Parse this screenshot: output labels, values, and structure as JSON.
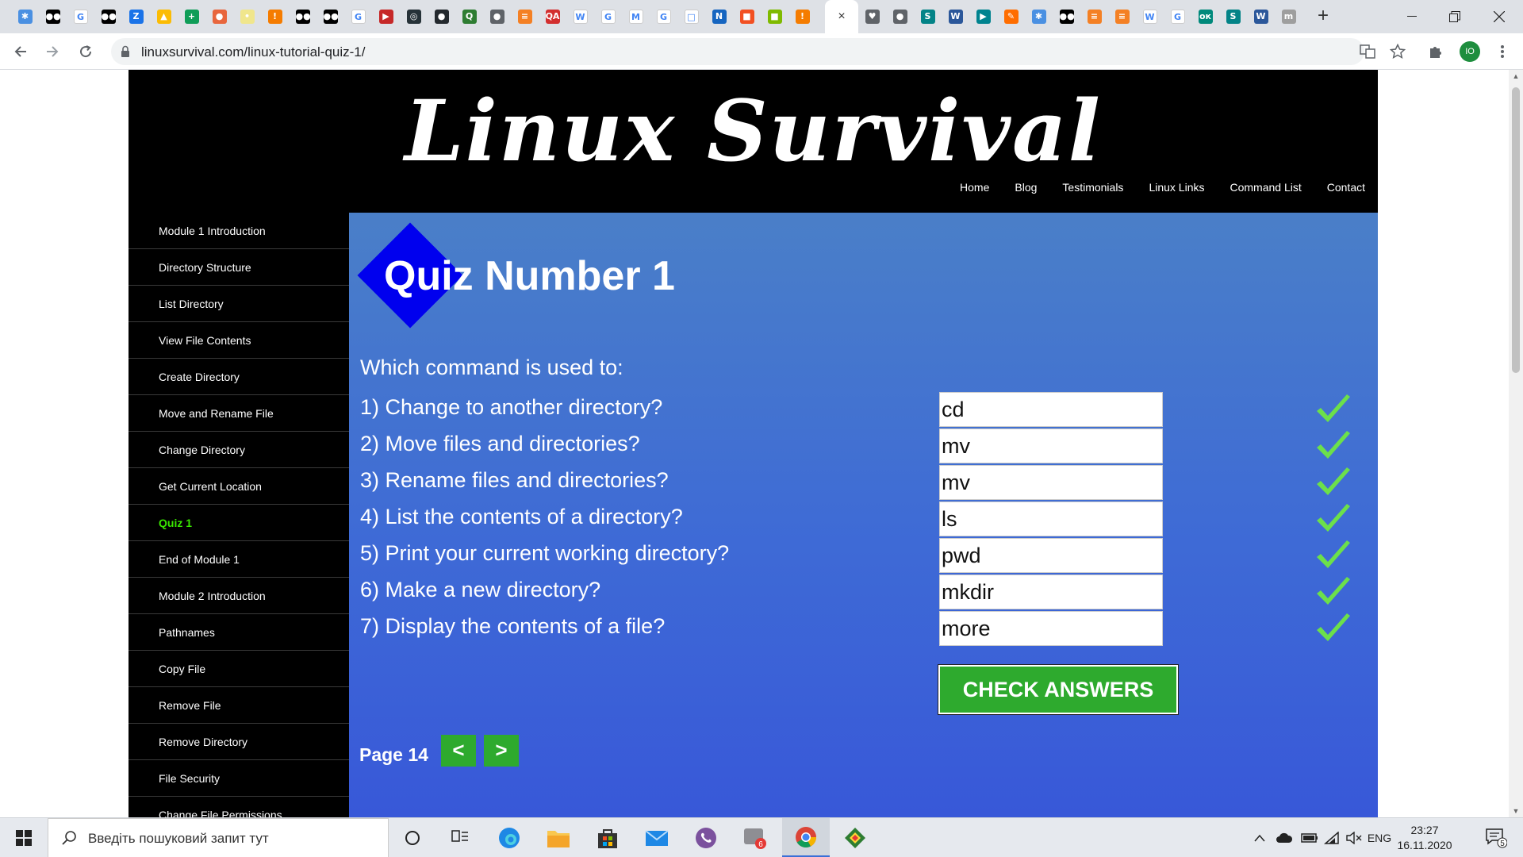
{
  "browser": {
    "url": "linuxsurvival.com/linux-tutorial-quiz-1/",
    "tab_close": "×",
    "new_tab": "+",
    "favicons": [
      {
        "name": "app-tab-icon",
        "color": "#4a90e2",
        "glyph": "✱"
      },
      {
        "name": "medium-tab-icon",
        "color": "#000000",
        "glyph": "●●"
      },
      {
        "name": "google-tab-icon",
        "color": "#ffffff",
        "glyph": "G"
      },
      {
        "name": "medium-tab-icon",
        "color": "#000000",
        "glyph": "●●"
      },
      {
        "name": "z-tab-icon",
        "color": "#1a73e8",
        "glyph": "Z"
      },
      {
        "name": "drive-tab-icon",
        "color": "#fbbc04",
        "glyph": "▲"
      },
      {
        "name": "plus-tab-icon",
        "color": "#0f9d58",
        "glyph": "+"
      },
      {
        "name": "ball-tab-icon",
        "color": "#e8663d",
        "glyph": "●"
      },
      {
        "name": "bulb-tab-icon",
        "color": "#f0e68c",
        "glyph": "•"
      },
      {
        "name": "info-tab-icon",
        "color": "#f57c00",
        "glyph": "!"
      },
      {
        "name": "medium-tab-icon",
        "color": "#000000",
        "glyph": "●●"
      },
      {
        "name": "medium-tab-icon",
        "color": "#000000",
        "glyph": "●●"
      },
      {
        "name": "google-tab-icon",
        "color": "#ffffff",
        "glyph": "G"
      },
      {
        "name": "flag-tab-icon",
        "color": "#c62828",
        "glyph": "▶"
      },
      {
        "name": "circle-tab-icon",
        "color": "#263238",
        "glyph": "◎"
      },
      {
        "name": "github-tab-icon",
        "color": "#24292e",
        "glyph": "●"
      },
      {
        "name": "qa-tab-icon",
        "color": "#2e7d32",
        "glyph": "Q"
      },
      {
        "name": "globe-tab-icon",
        "color": "#5f6368",
        "glyph": "●"
      },
      {
        "name": "stack-tab-icon",
        "color": "#f48024",
        "glyph": "≡"
      },
      {
        "name": "qa-tab-icon",
        "color": "#d32f2f",
        "glyph": "QA"
      },
      {
        "name": "wiki-tab-icon",
        "color": "#ffffff",
        "glyph": "W"
      },
      {
        "name": "google-tab-icon",
        "color": "#ffffff",
        "glyph": "G"
      },
      {
        "name": "gmail-tab-icon",
        "color": "#ffffff",
        "glyph": "M"
      },
      {
        "name": "google-tab-icon",
        "color": "#ffffff",
        "glyph": "G"
      },
      {
        "name": "square-tab-icon",
        "color": "#ffffff",
        "glyph": "□"
      },
      {
        "name": "n-tab-icon",
        "color": "#1565c0",
        "glyph": "N"
      },
      {
        "name": "windows-tab-icon",
        "color": "#f25022",
        "glyph": "■"
      },
      {
        "name": "windows-tab-icon",
        "color": "#7fba00",
        "glyph": "■"
      },
      {
        "name": "info-tab-icon",
        "color": "#f57c00",
        "glyph": "!"
      }
    ],
    "favicons_right": [
      {
        "name": "pocket-tab-icon",
        "color": "#5f6368",
        "glyph": "♥"
      },
      {
        "name": "globe-tab-icon",
        "color": "#5f6368",
        "glyph": "●"
      },
      {
        "name": "sharepoint-tab-icon",
        "color": "#038387",
        "glyph": "S"
      },
      {
        "name": "word-tab-icon",
        "color": "#2b579a",
        "glyph": "W"
      },
      {
        "name": "play-tab-icon",
        "color": "#00838f",
        "glyph": "▶"
      },
      {
        "name": "pen-tab-icon",
        "color": "#ff6d00",
        "glyph": "✎"
      },
      {
        "name": "app-tab-icon",
        "color": "#4a90e2",
        "glyph": "✱"
      },
      {
        "name": "medium-tab-icon",
        "color": "#000000",
        "glyph": "●●"
      },
      {
        "name": "stack-tab-icon",
        "color": "#f48024",
        "glyph": "≡"
      },
      {
        "name": "stack-tab-icon",
        "color": "#f48024",
        "glyph": "≡"
      },
      {
        "name": "wiki-tab-icon",
        "color": "#ffffff",
        "glyph": "W"
      },
      {
        "name": "google-tab-icon",
        "color": "#ffffff",
        "glyph": "G"
      },
      {
        "name": "ok-tab-icon",
        "color": "#00897b",
        "glyph": "ок"
      },
      {
        "name": "sharepoint-tab-icon",
        "color": "#038387",
        "glyph": "S"
      },
      {
        "name": "word-tab-icon",
        "color": "#2b579a",
        "glyph": "W"
      },
      {
        "name": "mi-tab-icon",
        "color": "#9e9e9e",
        "glyph": "m"
      }
    ],
    "avatar_initials": "IO"
  },
  "site": {
    "title": "Linux Survival",
    "nav": [
      "Home",
      "Blog",
      "Testimonials",
      "Linux Links",
      "Command List",
      "Contact"
    ],
    "sidebar": [
      {
        "label": "Module 1 Introduction",
        "active": false
      },
      {
        "label": "Directory Structure",
        "active": false
      },
      {
        "label": "List Directory",
        "active": false
      },
      {
        "label": "View File Contents",
        "active": false
      },
      {
        "label": "Create Directory",
        "active": false
      },
      {
        "label": "Move and Rename File",
        "active": false
      },
      {
        "label": "Change Directory",
        "active": false
      },
      {
        "label": "Get Current Location",
        "active": false
      },
      {
        "label": "Quiz 1",
        "active": true
      },
      {
        "label": "End of Module 1",
        "active": false
      },
      {
        "label": "Module 2 Introduction",
        "active": false
      },
      {
        "label": "Pathnames",
        "active": false
      },
      {
        "label": "Copy File",
        "active": false
      },
      {
        "label": "Remove File",
        "active": false
      },
      {
        "label": "Remove Directory",
        "active": false
      },
      {
        "label": "File Security",
        "active": false
      },
      {
        "label": "Change File Permissions",
        "active": false
      }
    ]
  },
  "quiz": {
    "title": "Quiz Number 1",
    "prompt": "Which command is used to:",
    "questions": [
      {
        "text": "1) Change to another directory?",
        "answer": "cd",
        "correct": true
      },
      {
        "text": "2) Move files and directories?",
        "answer": "mv",
        "correct": true
      },
      {
        "text": "3) Rename files and directories?",
        "answer": "mv",
        "correct": true
      },
      {
        "text": "4) List the contents of a directory?",
        "answer": "ls",
        "correct": true
      },
      {
        "text": "5) Print your current working directory?",
        "answer": "pwd",
        "correct": true
      },
      {
        "text": "6) Make a new directory?",
        "answer": "mkdir",
        "correct": true
      },
      {
        "text": "7) Display the contents of a file?",
        "answer": "more",
        "correct": true
      }
    ],
    "check_button": "CHECK ANSWERS",
    "page_label": "Page 14",
    "prev_label": "<",
    "next_label": ">"
  },
  "taskbar": {
    "search_placeholder": "Введіть пошуковий запит тут",
    "language": "ENG",
    "time": "23:27",
    "date": "16.11.2020",
    "mail_badge": "6",
    "notification_count": "5"
  },
  "colors": {
    "accent_green": "#2eaa2e",
    "active_sidebar": "#39e600",
    "check_mark": "#6ce04a",
    "diamond": "#0000ee"
  }
}
